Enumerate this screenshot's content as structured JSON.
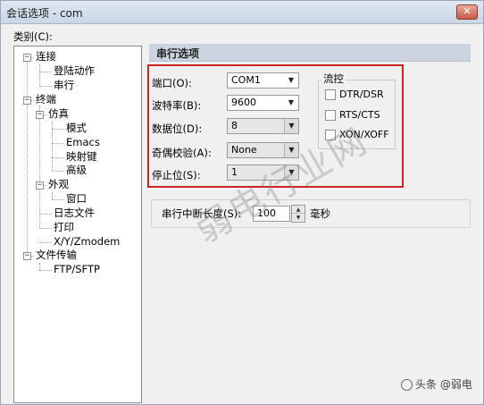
{
  "window": {
    "title": "会话选项 - com",
    "close_glyph": "✕"
  },
  "category_label": "类别(C):",
  "tree": {
    "items": [
      {
        "label": "连接"
      },
      {
        "label": "登陆动作"
      },
      {
        "label": "串行"
      },
      {
        "label": "终端"
      },
      {
        "label": "仿真"
      },
      {
        "label": "模式"
      },
      {
        "label": "Emacs"
      },
      {
        "label": "映射键"
      },
      {
        "label": "高级"
      },
      {
        "label": "外观"
      },
      {
        "label": "窗口"
      },
      {
        "label": "日志文件"
      },
      {
        "label": "打印"
      },
      {
        "label": "X/Y/Zmodem"
      },
      {
        "label": "文件传输"
      },
      {
        "label": "FTP/SFTP"
      }
    ],
    "expander_glyph": "−"
  },
  "panel": {
    "title": "串行选项",
    "fields": [
      {
        "label": "端口(O):",
        "value": "COM1"
      },
      {
        "label": "波特率(B):",
        "value": "9600"
      },
      {
        "label": "数据位(D):",
        "value": "8"
      },
      {
        "label": "奇偶校验(A):",
        "value": "None"
      },
      {
        "label": "停止位(S):",
        "value": "1"
      }
    ],
    "dropdown_glyph": "▼",
    "flow_control": {
      "title": "流控",
      "options": [
        {
          "label": "DTR/DSR",
          "checked": false
        },
        {
          "label": "RTS/CTS",
          "checked": false
        },
        {
          "label": "XON/XOFF",
          "checked": false
        }
      ]
    },
    "break_length": {
      "label": "串行中断长度(S):",
      "value": "100",
      "unit": "毫秒",
      "up_glyph": "▲",
      "down_glyph": "▼"
    }
  },
  "watermark": {
    "text": "弱电行业网",
    "footer": "弱电行业网",
    "footer_sub": "头条 @弱电"
  }
}
